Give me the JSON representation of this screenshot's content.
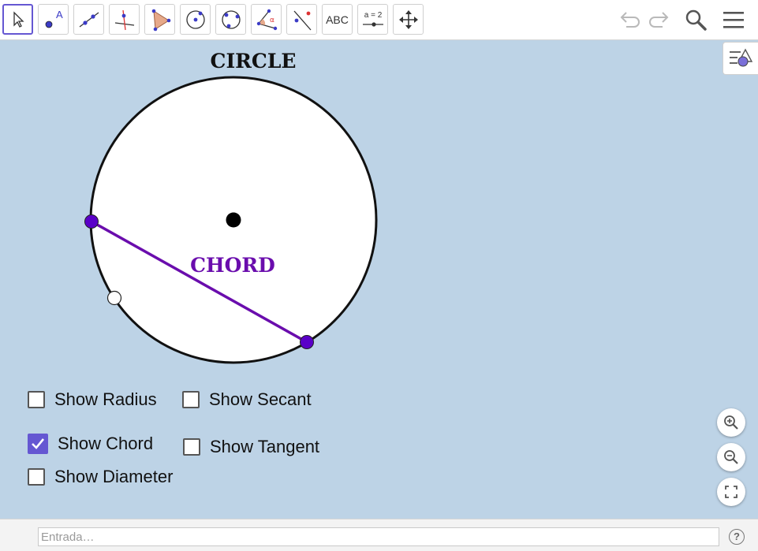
{
  "toolbar": {
    "tools": [
      {
        "name": "move-tool",
        "icon": "arrow-pointer-icon",
        "selected": true
      },
      {
        "name": "point-tool",
        "icon": "point-icon",
        "label": "A"
      },
      {
        "name": "line-tool",
        "icon": "line-icon"
      },
      {
        "name": "perpendicular-tool",
        "icon": "perpendicular-line-icon"
      },
      {
        "name": "polygon-tool",
        "icon": "polygon-icon"
      },
      {
        "name": "circle-center-tool",
        "icon": "circle-center-point-icon"
      },
      {
        "name": "circle-three-points-tool",
        "icon": "circle-three-points-icon"
      },
      {
        "name": "angle-tool",
        "icon": "angle-icon",
        "label": "α"
      },
      {
        "name": "reflect-tool",
        "icon": "reflect-icon"
      },
      {
        "name": "text-tool",
        "icon": "text-icon",
        "label": "ABC"
      },
      {
        "name": "slider-tool",
        "icon": "slider-icon",
        "label": "a = 2"
      },
      {
        "name": "move-view-tool",
        "icon": "move-graphics-view-icon"
      }
    ],
    "right": [
      "undo-icon",
      "redo-icon",
      "search-icon",
      "menu-icon"
    ]
  },
  "graphics": {
    "background": "#bdd3e6",
    "circle_title": "CIRCLE",
    "chord_label": "CHORD",
    "chord_color": "#6a0dad",
    "point_color": "#5a00c8",
    "style_bar_icon": "style-bar-toggle-icon"
  },
  "checkboxes": [
    {
      "name": "show-radius",
      "label": "Show Radius",
      "checked": false
    },
    {
      "name": "show-secant",
      "label": "Show Secant",
      "checked": false
    },
    {
      "name": "show-chord",
      "label": "Show Chord",
      "checked": true
    },
    {
      "name": "show-tangent",
      "label": "Show Tangent",
      "checked": false
    },
    {
      "name": "show-diameter",
      "label": "Show Diameter",
      "checked": false
    }
  ],
  "zoom": [
    "zoom-in-icon",
    "zoom-out-icon",
    "fullscreen-icon"
  ],
  "input_bar": {
    "placeholder": "Entrada…",
    "help": "?"
  },
  "accent": "#6557d2"
}
